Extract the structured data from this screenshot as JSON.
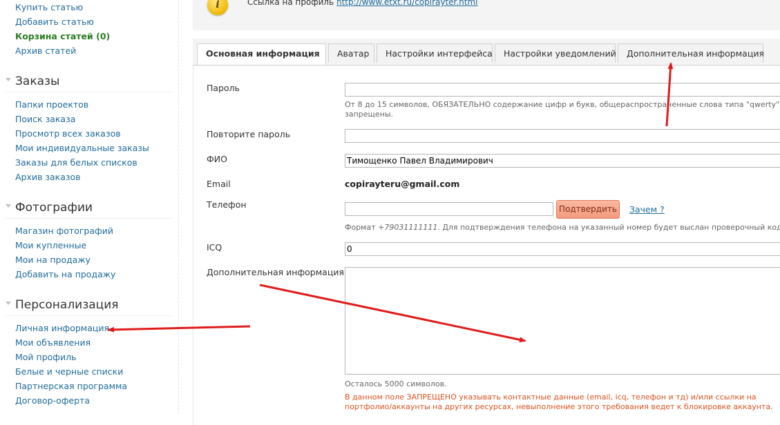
{
  "sidebar": {
    "articles": [
      {
        "label": "Купить статью"
      },
      {
        "label": "Добавить статью"
      },
      {
        "label": "Корзина статей (0)"
      },
      {
        "label": "Архив статей"
      }
    ],
    "orders": {
      "title": "Заказы",
      "items": [
        {
          "label": "Папки проектов"
        },
        {
          "label": "Поиск заказа"
        },
        {
          "label": "Просмотр всех заказов"
        },
        {
          "label": "Мои индивидуальные заказы"
        },
        {
          "label": "Заказы для белых списков"
        },
        {
          "label": "Архив заказов"
        }
      ]
    },
    "photos": {
      "title": "Фотографии",
      "items": [
        {
          "label": "Магазин фотографий"
        },
        {
          "label": "Мои купленные"
        },
        {
          "label": "Мои на продажу"
        },
        {
          "label": "Добавить на продажу"
        }
      ]
    },
    "personal": {
      "title": "Персонализация",
      "items": [
        {
          "label": "Личная информация"
        },
        {
          "label": "Мои объявления"
        },
        {
          "label": "Мой профиль"
        },
        {
          "label": "Белые и черные списки"
        },
        {
          "label": "Партнерская программа"
        },
        {
          "label": "Договор-оферта"
        }
      ]
    }
  },
  "profile": {
    "label": "Ссылка на профиль",
    "url": "http://www.etxt.ru/copirayter.html",
    "icon": "info-icon"
  },
  "tabs": [
    {
      "label": "Основная информация",
      "active": true
    },
    {
      "label": "Аватар"
    },
    {
      "label": "Настройки интерфейса"
    },
    {
      "label": "Настройки уведомлений"
    },
    {
      "label": "Дополнительная информация"
    }
  ],
  "form": {
    "password": {
      "label": "Пароль",
      "value": "",
      "hint_line1": "От 8 до 15 символов, ОБЯЗАТЕЛЬНО содержание цифр и букв, общераспространенные слова типа \"qwerty\"",
      "hint_line2": "запрещены."
    },
    "password_repeat": {
      "label": "Повторите пароль",
      "value": ""
    },
    "fio": {
      "label": "ФИО",
      "value": "Тимощенко Павел Владимирович"
    },
    "email": {
      "label": "Email",
      "value": "copirayteru@gmail.com"
    },
    "phone": {
      "label": "Телефон",
      "value": "",
      "confirm_label": "Подтвердить",
      "why_label": "Зачем ?",
      "hint_prefix": "Формат ",
      "hint_format": "+79031111111",
      "hint_rest": ". Для подтверждения телефона на указанный номер будет выслан проверочный код."
    },
    "icq": {
      "label": "ICQ",
      "value": "0"
    },
    "extra": {
      "label": "Дополнительная информация",
      "value": "",
      "remaining": "Осталось 5000 символов.",
      "warning_line1": "В данном поле ЗАПРЕЩЕНО указывать контактные данные (email, icq, телефон и тд) и/или ссылки на",
      "warning_line2": "портфолио/аккаунты на других ресурсах, невыполнение этого требования ведет к блокировке аккаунта."
    }
  },
  "colors": {
    "link": "#1f6b9b",
    "active_link": "#2a7d22",
    "warning": "#d9531e",
    "confirm_button": "#f39a7d",
    "annotation_arrow": "#e01b1b"
  }
}
